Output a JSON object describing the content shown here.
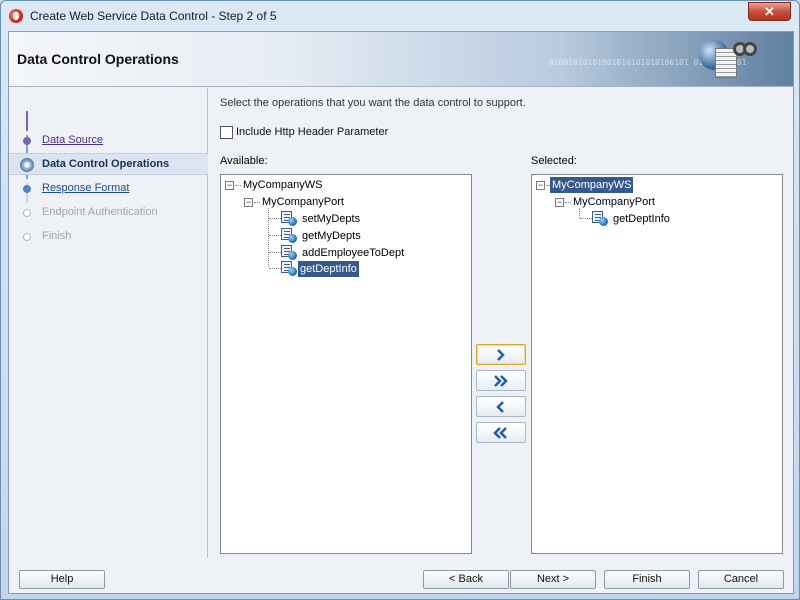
{
  "window": {
    "title": "Create Web Service Data Control - Step 2 of 5",
    "close_glyph": "✕"
  },
  "banner": {
    "title": "Data Control Operations",
    "decoration_binary": "01001010101001010101010100101  01001010101"
  },
  "steps": [
    {
      "label": "Data Source",
      "state": "visited"
    },
    {
      "label": "Data Control Operations",
      "state": "current"
    },
    {
      "label": "Response Format",
      "state": "next"
    },
    {
      "label": "Endpoint Authentication",
      "state": "disabled"
    },
    {
      "label": "Finish",
      "state": "disabled"
    }
  ],
  "content": {
    "instruction": "Select the operations that you want the data control to support.",
    "include_header_label": "Include Http Header Parameter",
    "include_header_checked": false,
    "available_label": "Available:",
    "selected_label": "Selected:"
  },
  "available_tree": {
    "service": "MyCompanyWS",
    "port": "MyCompanyPort",
    "operations": [
      "setMyDepts",
      "getMyDepts",
      "addEmployeeToDept",
      "getDeptInfo"
    ],
    "selected_item": "getDeptInfo"
  },
  "selected_tree": {
    "service": "MyCompanyWS",
    "port": "MyCompanyPort",
    "operations": [
      "getDeptInfo"
    ],
    "selected_item": "MyCompanyWS"
  },
  "expander_glyph": "−",
  "move_buttons": [
    "add",
    "add-all",
    "remove",
    "remove-all"
  ],
  "buttons": {
    "help": "Help",
    "back": "< Back",
    "next": "Next >",
    "finish": "Finish",
    "cancel": "Cancel"
  },
  "colors": {
    "selection": "#34598c",
    "banner_accent": "#5f7f9f",
    "focus_border": "#e0a530"
  }
}
